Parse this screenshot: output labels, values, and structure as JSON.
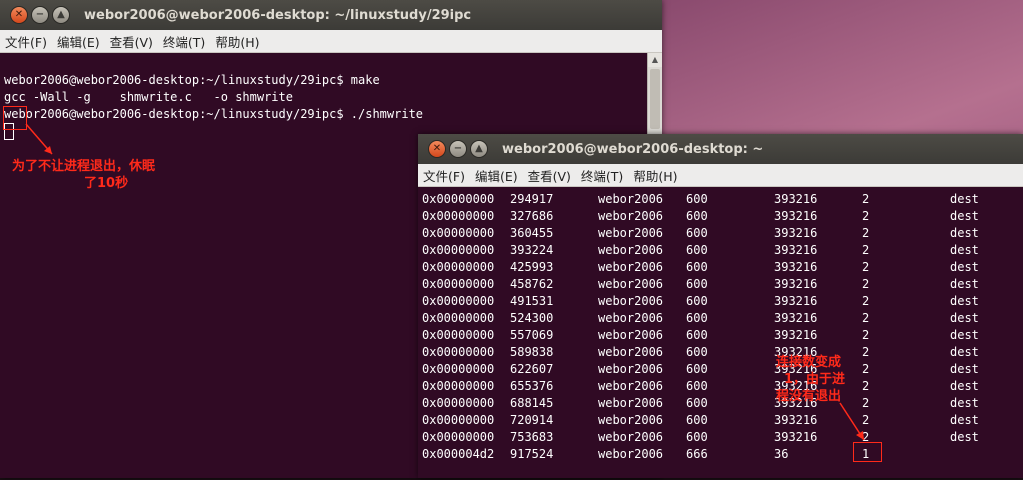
{
  "window1": {
    "title": "webor2006@webor2006-desktop: ~/linuxstudy/29ipc",
    "menu": [
      "文件(F)",
      "编辑(E)",
      "查看(V)",
      "终端(T)",
      "帮助(H)"
    ],
    "lines": [
      "webor2006@webor2006-desktop:~/linuxstudy/29ipc$ make",
      "gcc -Wall -g    shmwrite.c   -o shmwrite",
      "webor2006@webor2006-desktop:~/linuxstudy/29ipc$ ./shmwrite"
    ],
    "annotation_line1": "为了不让进程退出，休眠",
    "annotation_line2": "了10秒"
  },
  "window2": {
    "title": "webor2006@webor2006-desktop: ~",
    "menu": [
      "文件(F)",
      "编辑(E)",
      "查看(V)",
      "终端(T)",
      "帮助(H)"
    ],
    "rows": [
      [
        "0x00000000",
        "294917",
        "webor2006",
        "600",
        "393216",
        "2",
        "dest"
      ],
      [
        "0x00000000",
        "327686",
        "webor2006",
        "600",
        "393216",
        "2",
        "dest"
      ],
      [
        "0x00000000",
        "360455",
        "webor2006",
        "600",
        "393216",
        "2",
        "dest"
      ],
      [
        "0x00000000",
        "393224",
        "webor2006",
        "600",
        "393216",
        "2",
        "dest"
      ],
      [
        "0x00000000",
        "425993",
        "webor2006",
        "600",
        "393216",
        "2",
        "dest"
      ],
      [
        "0x00000000",
        "458762",
        "webor2006",
        "600",
        "393216",
        "2",
        "dest"
      ],
      [
        "0x00000000",
        "491531",
        "webor2006",
        "600",
        "393216",
        "2",
        "dest"
      ],
      [
        "0x00000000",
        "524300",
        "webor2006",
        "600",
        "393216",
        "2",
        "dest"
      ],
      [
        "0x00000000",
        "557069",
        "webor2006",
        "600",
        "393216",
        "2",
        "dest"
      ],
      [
        "0x00000000",
        "589838",
        "webor2006",
        "600",
        "393216",
        "2",
        "dest"
      ],
      [
        "0x00000000",
        "622607",
        "webor2006",
        "600",
        "393216",
        "2",
        "dest"
      ],
      [
        "0x00000000",
        "655376",
        "webor2006",
        "600",
        "393216",
        "2",
        "dest"
      ],
      [
        "0x00000000",
        "688145",
        "webor2006",
        "600",
        "393216",
        "2",
        "dest"
      ],
      [
        "0x00000000",
        "720914",
        "webor2006",
        "600",
        "393216",
        "2",
        "dest"
      ],
      [
        "0x00000000",
        "753683",
        "webor2006",
        "600",
        "393216",
        "2",
        "dest"
      ],
      [
        "0x000004d2",
        "917524",
        "webor2006",
        "666",
        "36",
        "1",
        ""
      ]
    ],
    "annotation_line1": "连接数变成",
    "annotation_line2": "1，由于进",
    "annotation_line3": "程没有退出"
  },
  "colors": {
    "terminal_bg": "#300a24",
    "annotation": "#ff2a1a"
  }
}
